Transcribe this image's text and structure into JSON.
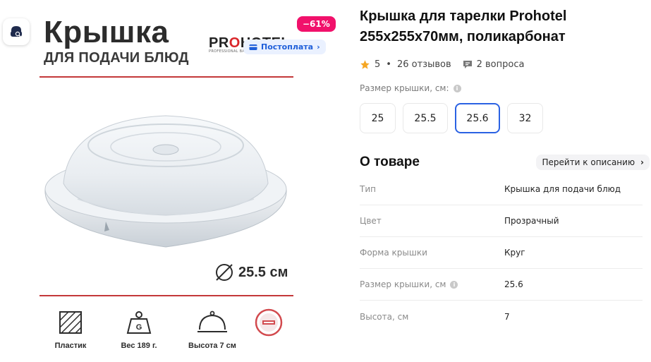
{
  "left": {
    "promo_title": "Крышка",
    "promo_subtitle": "ДЛЯ ПОДАЧИ БЛЮД",
    "brand_logo_pre": "PR",
    "brand_logo_o": "O",
    "brand_logo_post": "HOTEL",
    "brand_tagline": "PROFESSIONAL BAR & KITCHEN",
    "discount_badge": "−61%",
    "postpay_label": "Постоплата",
    "diameter_label": "25.5 см",
    "features": [
      {
        "label": "Пластик",
        "icon": "material-hatch-icon"
      },
      {
        "label": "Вес 189 г.",
        "icon": "weight-icon",
        "icon_text": "G"
      },
      {
        "label": "Высота 7 см",
        "icon": "cloche-icon"
      },
      {
        "label": "",
        "icon": "dishwasher-safe-badge-icon"
      }
    ]
  },
  "product": {
    "title": "Крышка для тарелки Prohotel 255x255x70мм, поликарбонат",
    "rating": "5",
    "reviews": "26 отзывов",
    "questions": "2 вопроса",
    "size_label": "Размер крышки, см:",
    "sizes": [
      "25",
      "25.5",
      "25.6",
      "32"
    ],
    "selected_size": "25.6"
  },
  "about": {
    "heading": "О товаре",
    "goto_label": "Перейти к описанию",
    "props": [
      {
        "name": "Тип",
        "value": "Крышка для подачи блюд"
      },
      {
        "name": "Цвет",
        "value": "Прозрачный"
      },
      {
        "name": "Форма крышки",
        "value": "Круг"
      },
      {
        "name": "Размер крышки, см",
        "value": "25.6"
      },
      {
        "name": "Высота, см",
        "value": "7"
      }
    ]
  },
  "colors": {
    "accent_blue": "#2b62e3",
    "discount_pink": "#f1116b",
    "star": "#f5a623",
    "divider_red": "#c4383a"
  }
}
